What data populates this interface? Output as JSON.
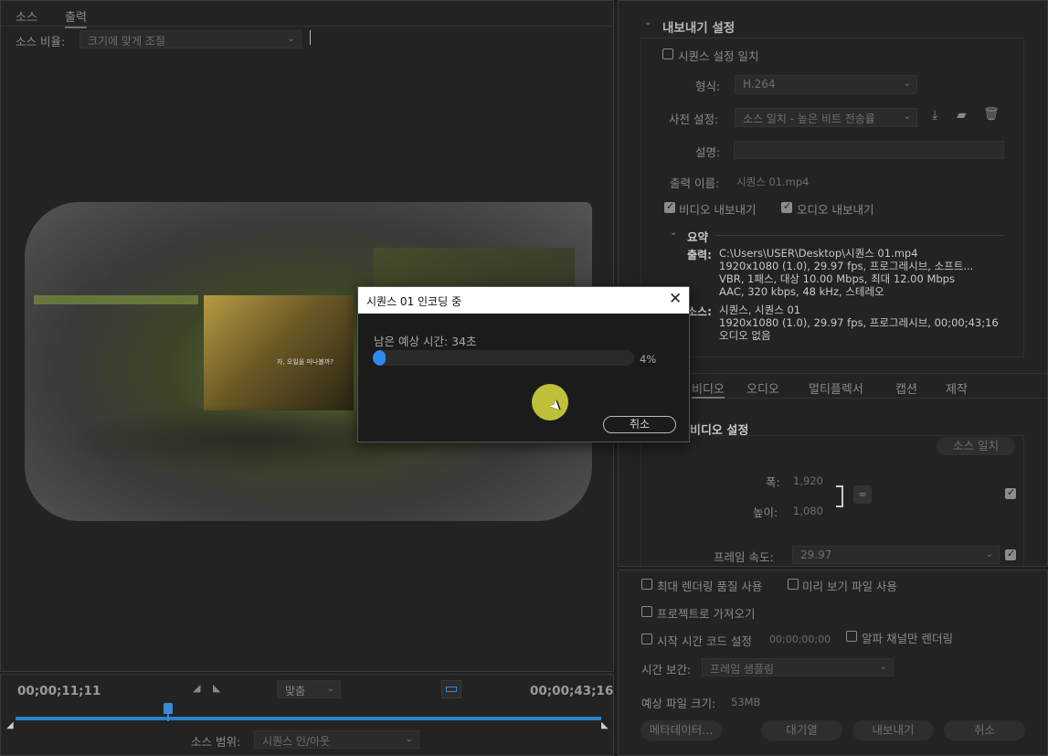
{
  "monitor": {
    "tabs": [
      "소스",
      "출력"
    ],
    "source_scale_label": "소스 비율:",
    "source_scale_value": "크기에 맞게 조절",
    "timecode_current": "00;00;11;11",
    "timecode_total": "00;00;43;16",
    "fit_label": "맞춤",
    "source_range_label": "소스 범위:",
    "source_range_value": "시퀀스 인/아웃",
    "subtitle_text": "자, 오일을 마나볼까?",
    "playhead_fraction": 0.26
  },
  "export": {
    "section_title": "내보내기 설정",
    "match_sequence_label": "시퀀스 설정 일치",
    "format_label": "형식:",
    "format_value": "H.264",
    "preset_label": "사전 설정:",
    "preset_value": "소스 일치 - 높은 비트 전송률",
    "comment_label": "설명:",
    "output_name_label": "출력 이름:",
    "output_name_value": "시퀀스 01.mp4",
    "export_video_label": "비디오 내보내기",
    "export_audio_label": "오디오 내보내기",
    "summary_title": "요약",
    "summary_output_label": "출력:",
    "summary_output_lines": [
      "C:\\Users\\USER\\Desktop\\시퀀스 01.mp4",
      "1920x1080 (1.0), 29.97 fps, 프로그레시브, 소프트...",
      "VBR, 1패스, 대상 10.00 Mbps, 최대 12.00 Mbps",
      "AAC, 320 kbps, 48 kHz, 스테레오"
    ],
    "summary_source_label": "소스:",
    "summary_source_lines": [
      "시퀀스, 시퀀스 01",
      "1920x1080 (1.0), 29.97 fps, 프로그레시브, 00;00;43;16",
      "오디오 없음"
    ],
    "tabs": [
      "비디오",
      "오디오",
      "멀티플렉서",
      "캡션",
      "제작"
    ],
    "video_settings_title": "비디오 설정",
    "match_source_button": "소스 일치",
    "width_label": "폭:",
    "width_value": "1,920",
    "height_label": "높이:",
    "height_value": "1,080",
    "frame_rate_label": "프레임 속도:",
    "frame_rate_value": "29.97",
    "max_render_label": "최대 렌더링 품질 사용",
    "use_preview_label": "미리 보기 파일 사용",
    "import_project_label": "프로젝트로 가져오기",
    "start_tc_label": "시작 시간 코드 설정",
    "start_tc_value": "00;00;00;00",
    "alpha_only_label": "알파 채널만 렌더링",
    "time_interp_label": "시간 보간:",
    "time_interp_value": "프레임 샘플링",
    "est_size_label": "예상 파일 크기:",
    "est_size_value": "53MB",
    "metadata_button": "메타데이터...",
    "queue_button": "대기열",
    "export_button": "내보내기",
    "cancel_button": "취소"
  },
  "dialog": {
    "title": "시퀀스 01 인코딩 중",
    "remaining_label": "남은 예상 시간: 34초",
    "progress_percent_text": "4%",
    "progress": 0.04,
    "cancel_label": "취소"
  }
}
